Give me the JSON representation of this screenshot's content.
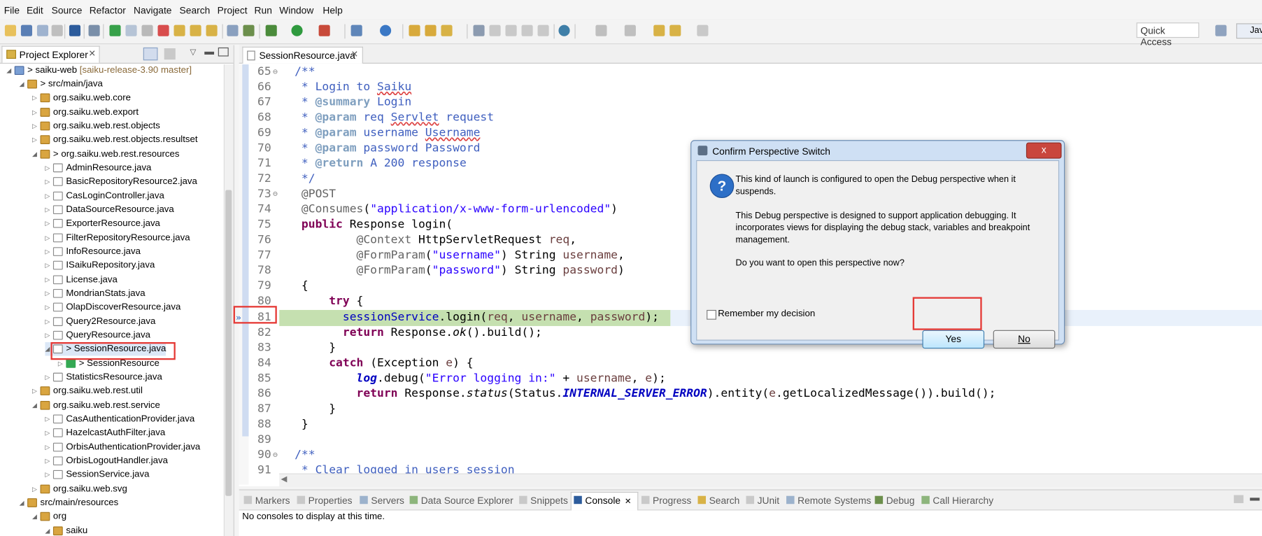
{
  "menu": [
    "File",
    "Edit",
    "Source",
    "Refactor",
    "Navigate",
    "Search",
    "Project",
    "Run",
    "Window",
    "Help"
  ],
  "toolbar": {
    "quick_access": "Quick Access",
    "perspective": "Java"
  },
  "explorer": {
    "tab_label": "Project Explorer",
    "items": [
      {
        "label": "> saiku-web",
        "suffix": "[saiku-release-3.90 master]",
        "icon": "project-icon"
      },
      {
        "label": "> src/main/java",
        "icon": "source-folder-icon"
      },
      {
        "label": "org.saiku.web.core",
        "icon": "package-icon"
      },
      {
        "label": "org.saiku.web.export",
        "icon": "package-icon"
      },
      {
        "label": "org.saiku.web.rest.objects",
        "icon": "package-icon"
      },
      {
        "label": "org.saiku.web.rest.objects.resultset",
        "icon": "package-icon"
      },
      {
        "label": "> org.saiku.web.rest.resources",
        "icon": "package-icon"
      },
      {
        "label": "AdminResource.java",
        "icon": "java-file-icon"
      },
      {
        "label": "BasicRepositoryResource2.java",
        "icon": "java-file-icon"
      },
      {
        "label": "CasLoginController.java",
        "icon": "java-file-icon"
      },
      {
        "label": "DataSourceResource.java",
        "icon": "java-file-icon"
      },
      {
        "label": "ExporterResource.java",
        "icon": "java-file-icon"
      },
      {
        "label": "FilterRepositoryResource.java",
        "icon": "java-file-icon"
      },
      {
        "label": "InfoResource.java",
        "icon": "java-file-icon"
      },
      {
        "label": "ISaikuRepository.java",
        "icon": "java-file-icon"
      },
      {
        "label": "License.java",
        "icon": "java-file-icon"
      },
      {
        "label": "MondrianStats.java",
        "icon": "java-file-icon"
      },
      {
        "label": "OlapDiscoverResource.java",
        "icon": "java-file-icon"
      },
      {
        "label": "Query2Resource.java",
        "icon": "java-file-icon"
      },
      {
        "label": "QueryResource.java",
        "icon": "java-file-icon"
      },
      {
        "label": "> SessionResource.java",
        "icon": "java-file-icon"
      },
      {
        "label": "> SessionResource",
        "icon": "class-icon"
      },
      {
        "label": "StatisticsResource.java",
        "icon": "java-file-icon"
      },
      {
        "label": "org.saiku.web.rest.util",
        "icon": "package-icon"
      },
      {
        "label": "org.saiku.web.rest.service",
        "icon": "package-icon"
      },
      {
        "label": "CasAuthenticationProvider.java",
        "icon": "java-file-icon"
      },
      {
        "label": "HazelcastAuthFilter.java",
        "icon": "java-file-icon"
      },
      {
        "label": "OrbisAuthenticationProvider.java",
        "icon": "java-file-icon"
      },
      {
        "label": "OrbisLogoutHandler.java",
        "icon": "java-file-icon"
      },
      {
        "label": "SessionService.java",
        "icon": "java-file-icon"
      },
      {
        "label": "org.saiku.web.svg",
        "icon": "package-icon"
      },
      {
        "label": "src/main/resources",
        "icon": "source-folder-icon"
      },
      {
        "label": "org",
        "icon": "package-icon"
      },
      {
        "label": "saiku",
        "icon": "package-icon"
      }
    ]
  },
  "editor": {
    "tab_label": "SessionResource.java",
    "lines": [
      {
        "n": "65",
        "text": "/**"
      },
      {
        "n": "66",
        "text": " * Login to Saiku"
      },
      {
        "n": "67",
        "text": " * @summary Login"
      },
      {
        "n": "68",
        "text": " * @param req Servlet request"
      },
      {
        "n": "69",
        "text": " * @param username Username"
      },
      {
        "n": "70",
        "text": " * @param password Password"
      },
      {
        "n": "71",
        "text": " * @return A 200 response"
      },
      {
        "n": "72",
        "text": " */"
      },
      {
        "n": "73",
        "text": "@POST"
      },
      {
        "n": "74",
        "text": "@Consumes(\"application/x-www-form-urlencoded\")"
      },
      {
        "n": "75",
        "text": "public Response login("
      },
      {
        "n": "76",
        "text": "        @Context HttpServletRequest req,"
      },
      {
        "n": "77",
        "text": "        @FormParam(\"username\") String username,"
      },
      {
        "n": "78",
        "text": "        @FormParam(\"password\") String password)"
      },
      {
        "n": "79",
        "text": "{"
      },
      {
        "n": "80",
        "text": "    try {"
      },
      {
        "n": "81",
        "text": "      sessionService.login(req, username, password);"
      },
      {
        "n": "82",
        "text": "      return Response.ok().build();"
      },
      {
        "n": "83",
        "text": "    }"
      },
      {
        "n": "84",
        "text": "    catch (Exception e) {"
      },
      {
        "n": "85",
        "text": "        log.debug(\"Error logging in:\" + username, e);"
      },
      {
        "n": "86",
        "text": "        return Response.status(Status.INTERNAL_SERVER_ERROR).entity(e.getLocalizedMessage()).build();"
      },
      {
        "n": "87",
        "text": "    }"
      },
      {
        "n": "88",
        "text": "}"
      },
      {
        "n": "89",
        "text": ""
      },
      {
        "n": "90",
        "text": "/**"
      },
      {
        "n": "91",
        "text": " * Clear logged in users session"
      }
    ]
  },
  "bottom_panel": {
    "tabs": [
      "Markers",
      "Properties",
      "Servers",
      "Data Source Explorer",
      "Snippets",
      "Console",
      "Progress",
      "Search",
      "JUnit",
      "Remote Systems",
      "Debug",
      "Call Hierarchy"
    ],
    "active_tab": "Console",
    "message": "No consoles to display at this time."
  },
  "dialog": {
    "title": "Confirm Perspective Switch",
    "message1": "This kind of launch is configured to open the Debug perspective when it suspends.",
    "message2": "This Debug perspective is designed to support application debugging.  It incorporates views for displaying the debug stack, variables and breakpoint management.",
    "question": "Do you want to open this perspective now?",
    "remember_label": "Remember my decision",
    "yes_label": "Yes",
    "no_label": "No",
    "close_label": "x"
  },
  "colors": {
    "highlight_line": "#c5e0b0",
    "callout": "#e53935",
    "dialog_frame": "#cfe0f4"
  }
}
